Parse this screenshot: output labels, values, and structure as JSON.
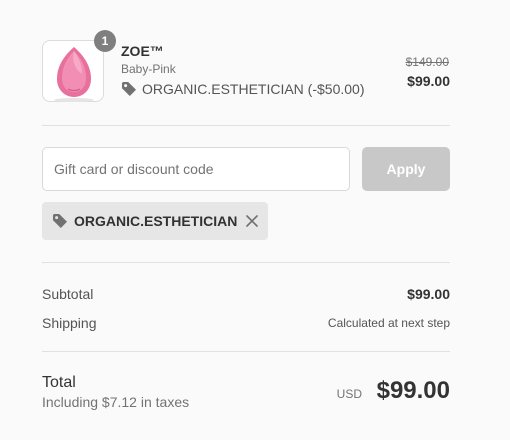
{
  "product": {
    "name": "ZOE™",
    "variant": "Baby-Pink",
    "quantity": "1",
    "discount_line": "ORGANIC.ESTHETICIAN (-$50.00)",
    "price_original": "$149.00",
    "price_final": "$99.00"
  },
  "discount_form": {
    "placeholder": "Gift card or discount code",
    "value": "",
    "apply_label": "Apply"
  },
  "applied_code": {
    "label": "ORGANIC.ESTHETICIAN"
  },
  "totals": {
    "subtotal_label": "Subtotal",
    "subtotal_value": "$99.00",
    "shipping_label": "Shipping",
    "shipping_value": "Calculated at next step",
    "total_label": "Total",
    "tax_note": "Including $7.12 in taxes",
    "currency": "USD",
    "total_value": "$99.00"
  },
  "colors": {
    "apply_button_disabled": "#c8c8c8",
    "chip_background": "#e6e6e6",
    "product_pink": "#e8709c"
  },
  "icons": {
    "tag": "tag-icon",
    "remove": "close-icon",
    "product_image": "product-image"
  }
}
